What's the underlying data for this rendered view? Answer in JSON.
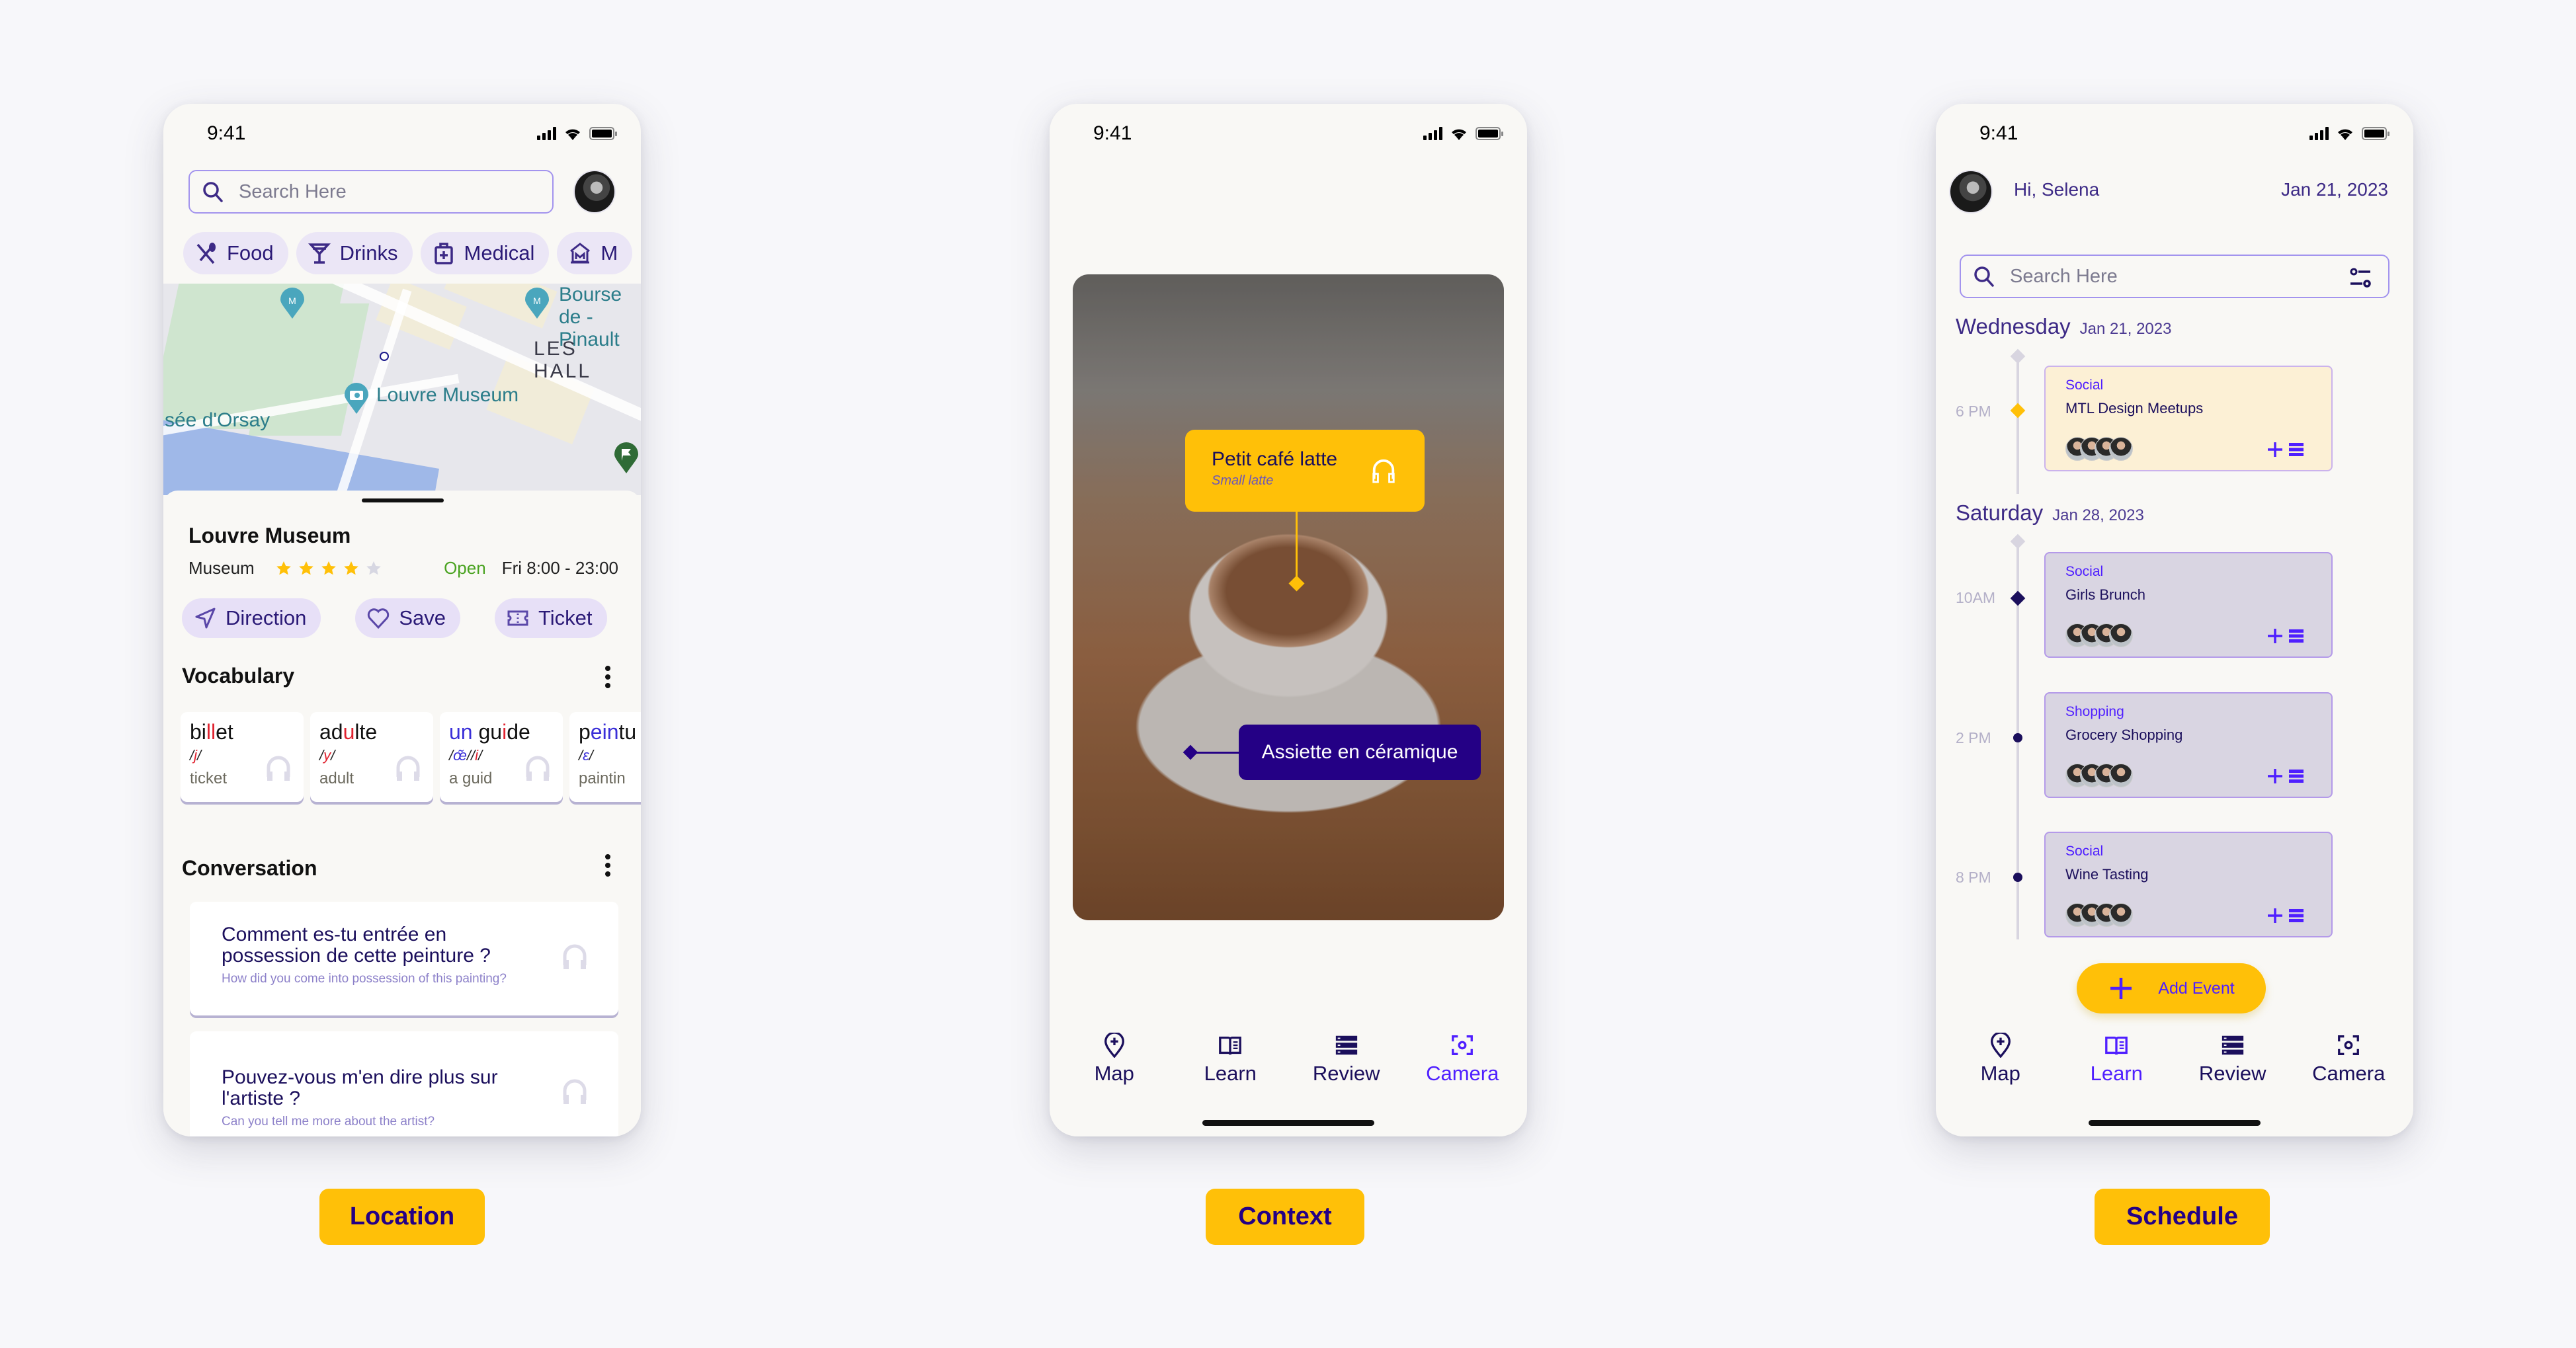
{
  "status_bar": {
    "time": "9:41"
  },
  "screens": {
    "location": {
      "search": {
        "placeholder": "Search Here"
      },
      "chips": [
        {
          "icon": "fork-spoon-icon",
          "label": "Food"
        },
        {
          "icon": "cocktail-icon",
          "label": "Drinks"
        },
        {
          "icon": "medical-kit-icon",
          "label": "Medical"
        },
        {
          "icon": "museum-icon",
          "label": "M"
        }
      ],
      "map_labels": [
        "Bourse de - Pinault",
        "LES HALL",
        "Louvre Museum",
        "sée d'Orsay"
      ],
      "place": {
        "name": "Louvre Museum",
        "category": "Museum",
        "rating": 4,
        "rating_max": 5,
        "status": "Open",
        "hours": "Fri 8:00 - 23:00"
      },
      "actions": [
        {
          "icon": "navigation-arrow-icon",
          "label": "Direction"
        },
        {
          "icon": "heart-icon",
          "label": "Save"
        },
        {
          "icon": "ticket-icon",
          "label": "Ticket"
        }
      ],
      "vocabulary": {
        "title": "Vocabulary",
        "cards": [
          {
            "word": [
              [
                "bi",
                ""
              ],
              [
                "ll",
                "red"
              ],
              [
                "et",
                ""
              ]
            ],
            "phonetic": [
              [
                "/",
                ""
              ],
              [
                "j",
                "red"
              ],
              [
                "/",
                ""
              ]
            ],
            "translation": "ticket"
          },
          {
            "word": [
              [
                "ad",
                ""
              ],
              [
                "u",
                "red"
              ],
              [
                "lte",
                ""
              ]
            ],
            "phonetic": [
              [
                "/",
                ""
              ],
              [
                "y",
                "red"
              ],
              [
                "/",
                ""
              ]
            ],
            "translation": "adult"
          },
          {
            "word": [
              [
                "un",
                "blue"
              ],
              [
                " gu",
                ""
              ],
              [
                "i",
                "red"
              ],
              [
                "de",
                ""
              ]
            ],
            "phonetic": [
              [
                "/",
                ""
              ],
              [
                "œ̃",
                "blue"
              ],
              [
                "//",
                ""
              ],
              [
                "i",
                "red"
              ],
              [
                "/",
                ""
              ]
            ],
            "translation": "a guid"
          },
          {
            "word": [
              [
                "p",
                ""
              ],
              [
                "ein",
                "blue"
              ],
              [
                "tu",
                ""
              ]
            ],
            "phonetic": [
              [
                "/",
                ""
              ],
              [
                "ɛ",
                "blue"
              ],
              [
                "/",
                ""
              ]
            ],
            "translation": "paintin"
          }
        ]
      },
      "conversation": {
        "title": "Conversation",
        "items": [
          {
            "fr": "Comment es-tu entrée en possession de cette peinture ?",
            "en": "How did you come into possession of this painting?"
          },
          {
            "fr": "Pouvez-vous m'en dire plus sur l'artiste ?",
            "en": "Can you tell me more about the artist?"
          }
        ]
      },
      "caption": "Location"
    },
    "context": {
      "tags": [
        {
          "text": "Petit café latte",
          "translation": "Small latte",
          "color": "#ffc008"
        },
        {
          "text": "Assiette en céramique",
          "color": "#240085"
        }
      ],
      "caption": "Context"
    },
    "schedule": {
      "greeting": "Hi, Selena",
      "date": "Jan 21, 2023",
      "search": {
        "placeholder": "Search Here"
      },
      "days": [
        {
          "day": "Wednesday",
          "date": "Jan 21, 2023",
          "events": [
            {
              "time": "6 PM",
              "category": "Social",
              "name": "MTL Design Meetups",
              "highlight": true
            }
          ]
        },
        {
          "day": "Saturday",
          "date": "Jan 28, 2023",
          "events": [
            {
              "time": "10AM",
              "category": "Social",
              "name": "Girls Brunch"
            },
            {
              "time": "2 PM",
              "category": "Shopping",
              "name": "Grocery Shopping"
            },
            {
              "time": "8 PM",
              "category": "Social",
              "name": "Wine Tasting"
            }
          ]
        }
      ],
      "add_event_label": "Add Event",
      "caption": "Schedule"
    }
  },
  "tabbar": [
    {
      "icon": "map-pin-icon",
      "label": "Map"
    },
    {
      "icon": "book-icon",
      "label": "Learn"
    },
    {
      "icon": "list-icon",
      "label": "Review"
    },
    {
      "icon": "camera-focus-icon",
      "label": "Camera"
    }
  ],
  "active_tab": {
    "context": "Camera",
    "schedule": "Learn"
  },
  "colors": {
    "accent_yellow": "#ffc008",
    "primary_indigo": "#240085",
    "active_purple": "#4f1fff",
    "open_green": "#4aa321"
  }
}
